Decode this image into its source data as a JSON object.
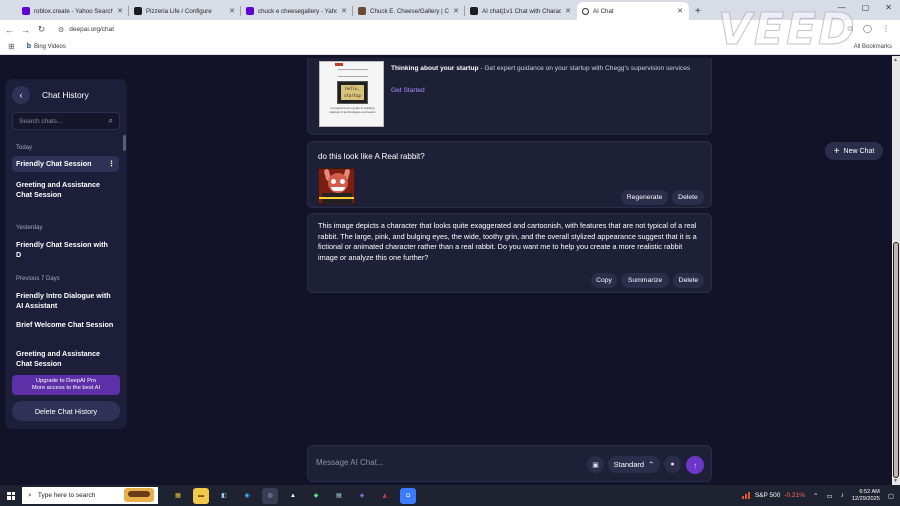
{
  "browser": {
    "tabs": [
      {
        "title": "roblox.create - Yahoo Search Re",
        "icon": "yahoo-icon",
        "active": false
      },
      {
        "title": "Pizzeria Life / Configure",
        "icon": "instagram-icon",
        "active": false
      },
      {
        "title": "chuck e cheesegallery - Yahoo",
        "icon": "yahoo-icon",
        "active": false
      },
      {
        "title": "Chuck E. Cheese/Gallery | Chuck",
        "icon": "image-icon",
        "active": false
      },
      {
        "title": "AI chat|1v1 Chat with Characte",
        "icon": "instagram-icon",
        "active": false
      },
      {
        "title": "AI Chat",
        "icon": "deepai-icon",
        "active": true
      }
    ],
    "url": "deepai.org/chat",
    "bookmark": "Bing Videos",
    "all_bookmarks": "All Bookmarks"
  },
  "watermark": "VEED",
  "sidebar": {
    "title": "Chat History",
    "search_placeholder": "Search chats...",
    "sections": [
      {
        "label": "Today",
        "items": [
          "Friendly Chat Session",
          "Greeting and Assistance Chat Session"
        ]
      },
      {
        "label": "Yesterday",
        "items": [
          "Friendly Chat Session with D"
        ]
      },
      {
        "label": "Previous 7 Days",
        "items": [
          "Friendly Intro Dialogue with AI Assistant",
          "Brief Welcome Chat Session",
          "Greeting and Assistance Chat Session"
        ]
      }
    ],
    "active_item": "Friendly Chat Session",
    "upgrade_line1": "Upgrade to DeepAI Pro",
    "upgrade_line2": "More access to the best AI",
    "delete_label": "Delete Chat History"
  },
  "ad": {
    "title": "Thinking about your startup",
    "body": " - Get expert guidance on your startup with Chegg's supervision services",
    "cta": "Get Started",
    "image_caption": "A programmer's guide to building startups & technologies and teams",
    "screen_text": "hello, startup"
  },
  "messages": {
    "user_text": "do this look like A Real rabbit?",
    "user_actions": [
      "Regenerate",
      "Delete"
    ],
    "bot_text": "This image depicts a character that looks quite exaggerated and cartoonish, with features that are not typical of a real rabbit. The large, pink, and bulging eyes, the wide, toothy grin, and the overall stylized appearance suggest that it is a fictional or animated character rather than a real rabbit. Do you want me to help you create a more realistic rabbit image or analyze this one further?",
    "bot_actions": [
      "Copy",
      "Summarize",
      "Delete"
    ]
  },
  "new_chat_label": "New Chat",
  "composer": {
    "placeholder": "Message AI Chat...",
    "mode": "Standard"
  },
  "taskbar": {
    "search_placeholder": "Type here to search",
    "stock_name": "S&P 500",
    "stock_change": "-0.21%",
    "time": "6:52 AM",
    "date": "12/29/2025"
  },
  "colors": {
    "page_bg": "#121329",
    "card_bg": "#1e2038",
    "accent": "#6a37c7",
    "link": "#a98cf7"
  }
}
